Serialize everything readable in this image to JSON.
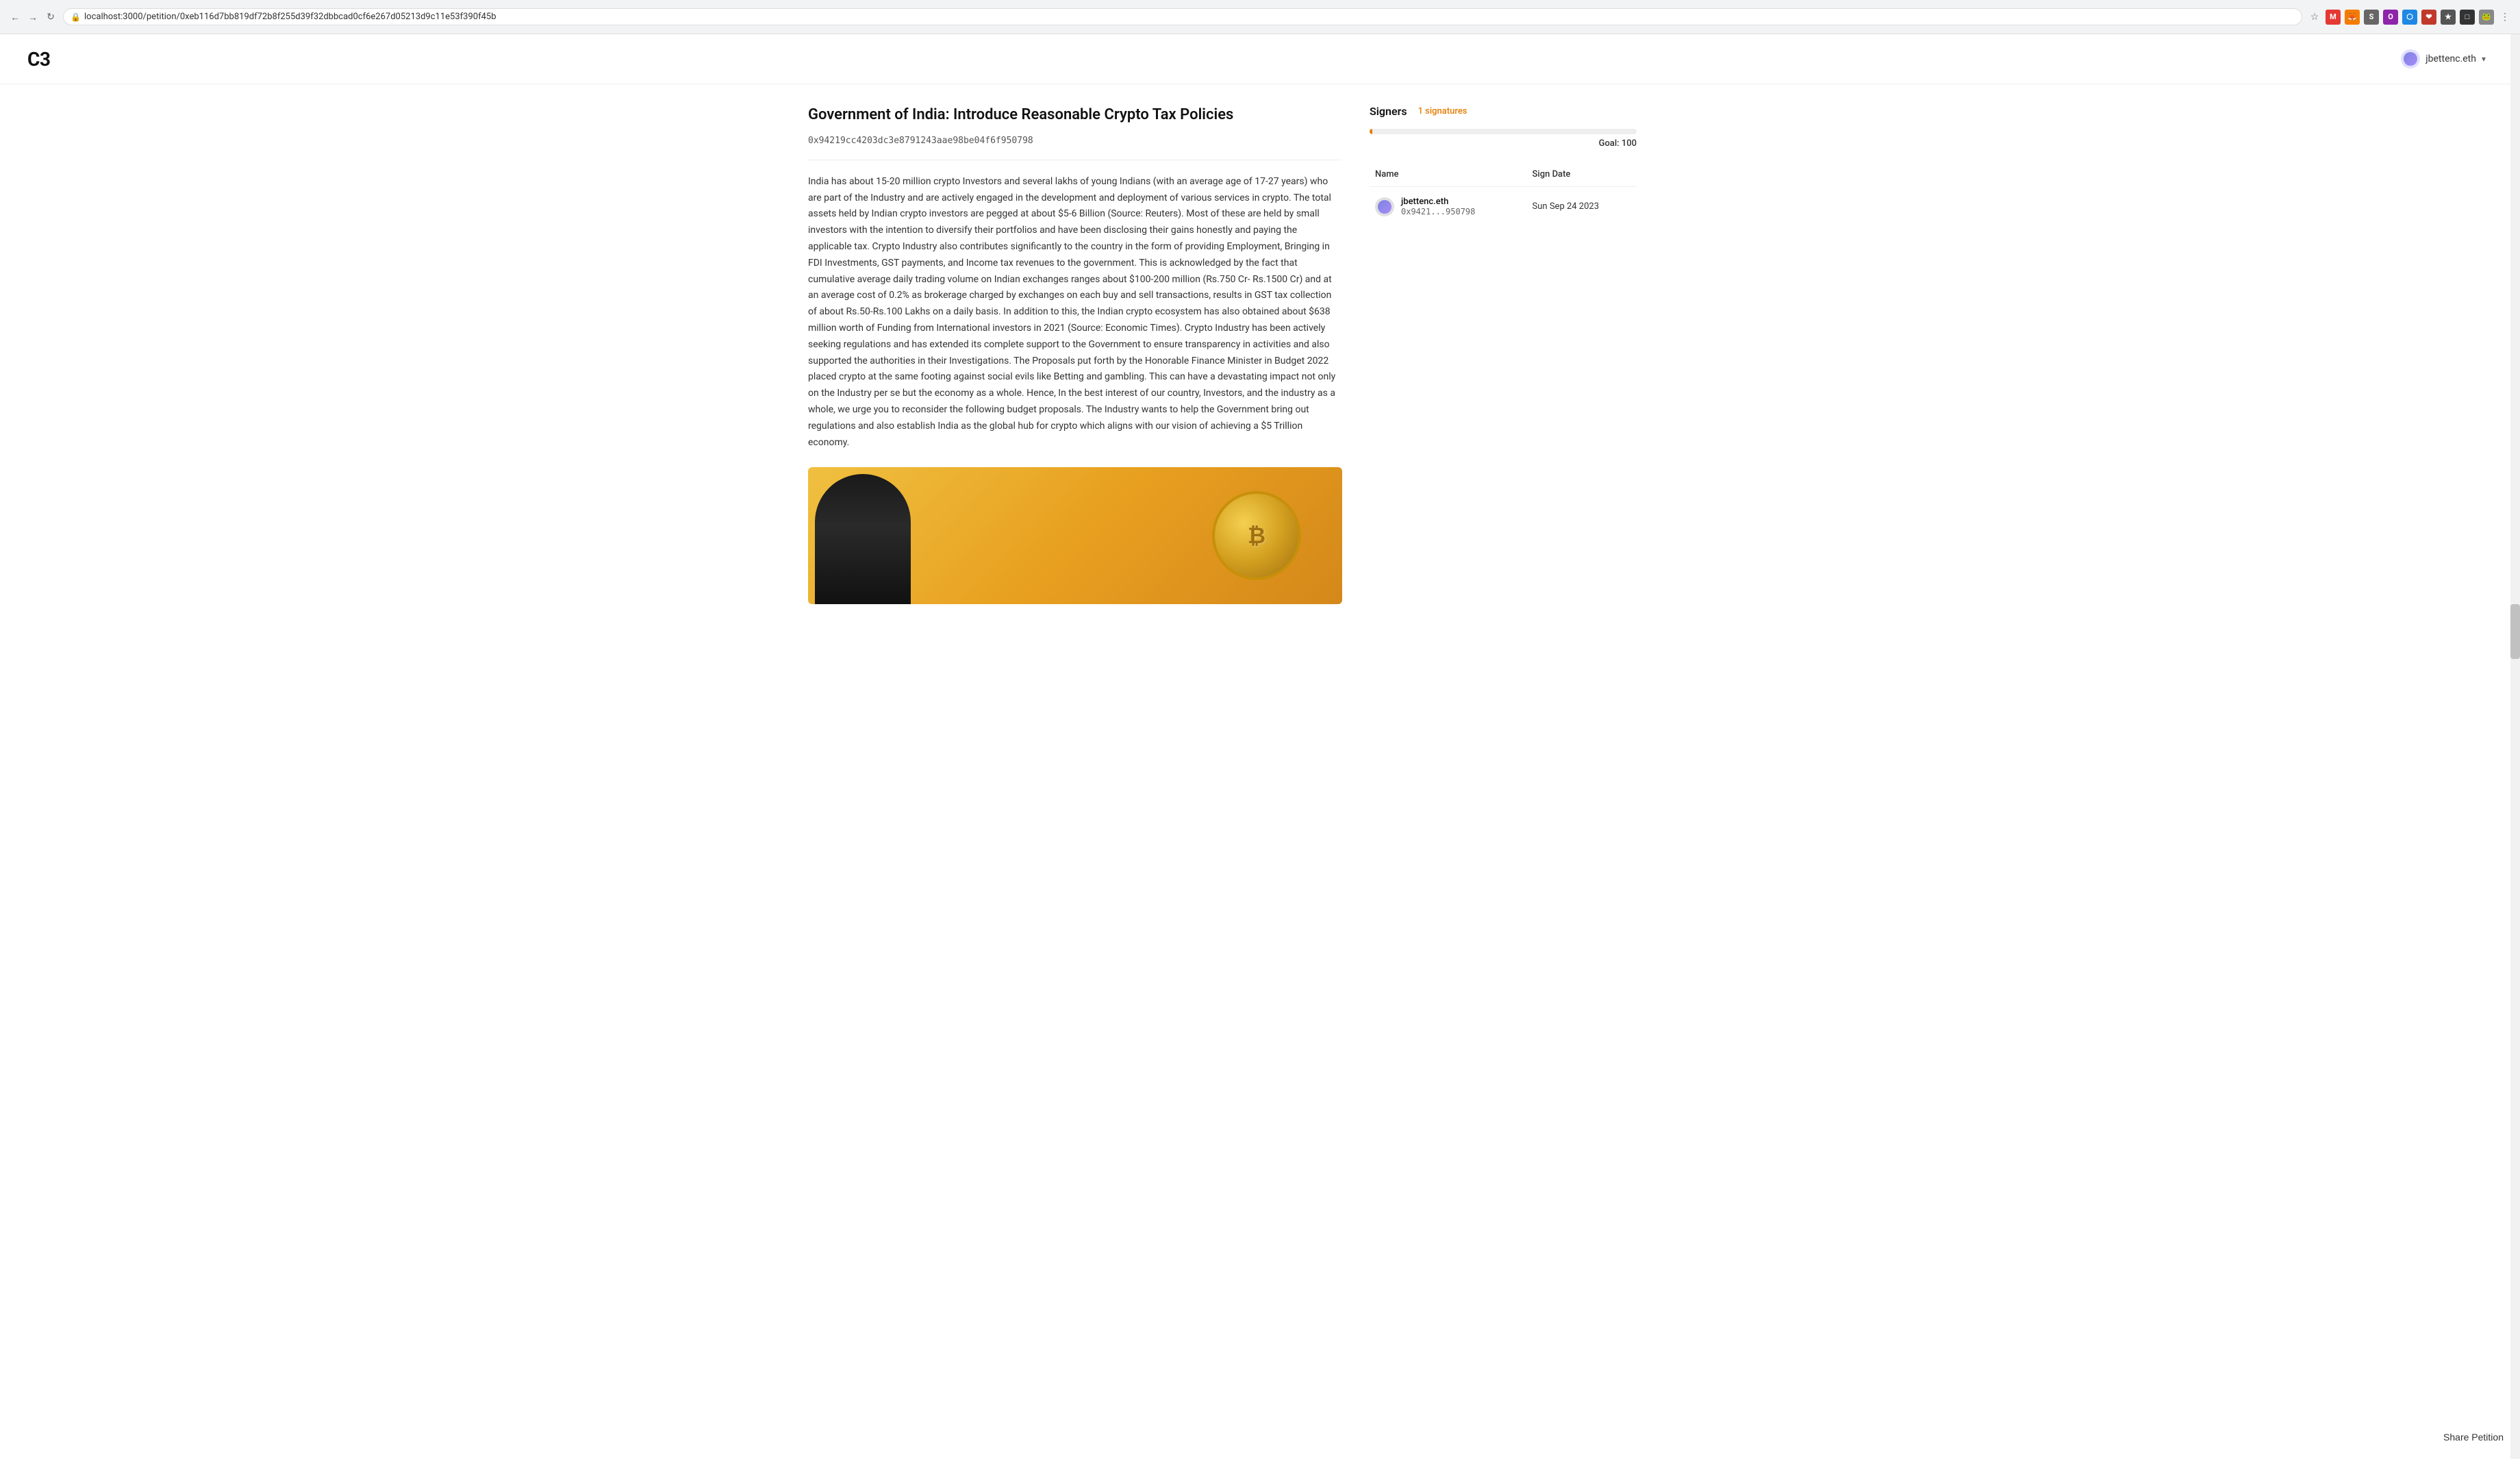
{
  "browser": {
    "url": "localhost:3000/petition/0xeb116d7bb819df72b8f255d39f32dbbcad0cf6e267d05213d9c11e53f390f45b",
    "back_label": "←",
    "forward_label": "→",
    "reload_label": "↻"
  },
  "header": {
    "logo": "C3",
    "user": {
      "name": "jbettenc.eth",
      "dropdown_icon": "▾"
    }
  },
  "petition": {
    "title": "Government of India: Introduce Reasonable Crypto Tax Policies",
    "address": "0x94219cc4203dc3e8791243aae98be04f6f950798",
    "body": "India has about 15-20 million crypto Investors and several lakhs of young Indians (with an average age of 17-27 years) who are part of the Industry and are actively engaged in the development and deployment of various services in crypto. The total assets held by Indian crypto investors are pegged at about $5-6 Billion (Source: Reuters). Most of these are held by small investors with the intention to diversify their portfolios and have been disclosing their gains honestly and paying the applicable tax. Crypto Industry also contributes significantly to the country in the form of providing Employment, Bringing in FDI Investments, GST payments, and Income tax revenues to the government. This is acknowledged by the fact that cumulative average daily trading volume on Indian exchanges ranges about $100-200 million (Rs.750 Cr- Rs.1500 Cr) and at an average cost of 0.2% as brokerage charged by exchanges on each buy and sell transactions, results in GST tax collection of about Rs.50-Rs.100 Lakhs on a daily basis. In addition to this, the Indian crypto ecosystem has also obtained about $638 million worth of Funding from International investors in 2021 (Source: Economic Times). Crypto Industry has been actively seeking regulations and has extended its complete support to the Government to ensure transparency in activities and also supported the authorities in their Investigations. The Proposals put forth by the Honorable Finance Minister in Budget 2022 placed crypto at the same footing against social evils like Betting and gambling. This can have a devastating impact not only on the Industry per se but the economy as a whole. Hence, In the best interest of our country, Investors, and the industry as a whole, we urge you to reconsider the following budget proposals. The Industry wants to help the Government bring out regulations and also establish India as the global hub for crypto which aligns with our vision of achieving a $5 Trillion economy."
  },
  "signers": {
    "title": "Signers",
    "count_label": "1 signatures",
    "progress_percent": 1,
    "goal_label": "Goal: 100",
    "columns": {
      "name": "Name",
      "sign_date": "Sign Date"
    },
    "rows": [
      {
        "name": "jbettenc.eth",
        "address": "0x9421...950798",
        "sign_date": "Sun Sep 24 2023"
      }
    ]
  },
  "share_button": {
    "label": "Share Petition"
  },
  "icons": {
    "lock": "🔒",
    "star": "☆",
    "menu": "⋮"
  }
}
